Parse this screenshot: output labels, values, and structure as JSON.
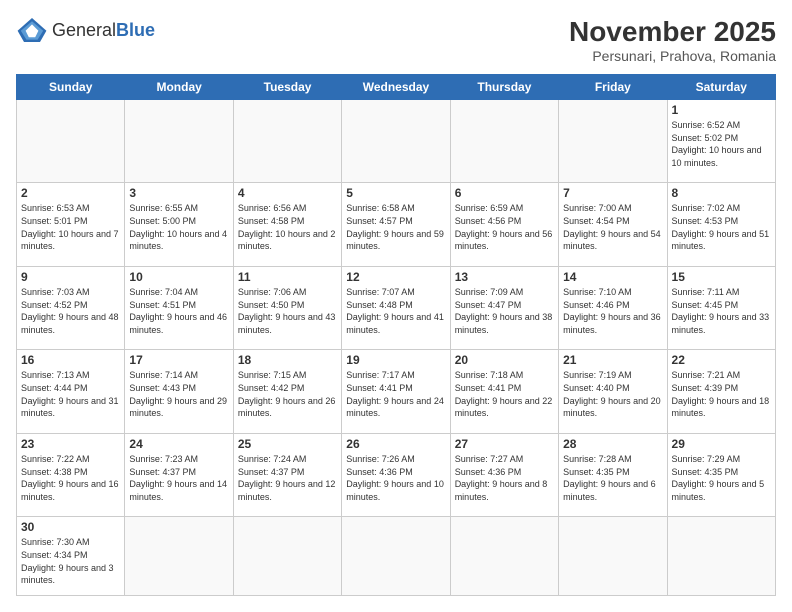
{
  "logo": {
    "text_general": "General",
    "text_blue": "Blue"
  },
  "header": {
    "month_year": "November 2025",
    "location": "Persunari, Prahova, Romania"
  },
  "days_of_week": [
    "Sunday",
    "Monday",
    "Tuesday",
    "Wednesday",
    "Thursday",
    "Friday",
    "Saturday"
  ],
  "weeks": [
    [
      {
        "day": "",
        "info": ""
      },
      {
        "day": "",
        "info": ""
      },
      {
        "day": "",
        "info": ""
      },
      {
        "day": "",
        "info": ""
      },
      {
        "day": "",
        "info": ""
      },
      {
        "day": "",
        "info": ""
      },
      {
        "day": "1",
        "info": "Sunrise: 6:52 AM\nSunset: 5:02 PM\nDaylight: 10 hours and 10 minutes."
      }
    ],
    [
      {
        "day": "2",
        "info": "Sunrise: 6:53 AM\nSunset: 5:01 PM\nDaylight: 10 hours and 7 minutes."
      },
      {
        "day": "3",
        "info": "Sunrise: 6:55 AM\nSunset: 5:00 PM\nDaylight: 10 hours and 4 minutes."
      },
      {
        "day": "4",
        "info": "Sunrise: 6:56 AM\nSunset: 4:58 PM\nDaylight: 10 hours and 2 minutes."
      },
      {
        "day": "5",
        "info": "Sunrise: 6:58 AM\nSunset: 4:57 PM\nDaylight: 9 hours and 59 minutes."
      },
      {
        "day": "6",
        "info": "Sunrise: 6:59 AM\nSunset: 4:56 PM\nDaylight: 9 hours and 56 minutes."
      },
      {
        "day": "7",
        "info": "Sunrise: 7:00 AM\nSunset: 4:54 PM\nDaylight: 9 hours and 54 minutes."
      },
      {
        "day": "8",
        "info": "Sunrise: 7:02 AM\nSunset: 4:53 PM\nDaylight: 9 hours and 51 minutes."
      }
    ],
    [
      {
        "day": "9",
        "info": "Sunrise: 7:03 AM\nSunset: 4:52 PM\nDaylight: 9 hours and 48 minutes."
      },
      {
        "day": "10",
        "info": "Sunrise: 7:04 AM\nSunset: 4:51 PM\nDaylight: 9 hours and 46 minutes."
      },
      {
        "day": "11",
        "info": "Sunrise: 7:06 AM\nSunset: 4:50 PM\nDaylight: 9 hours and 43 minutes."
      },
      {
        "day": "12",
        "info": "Sunrise: 7:07 AM\nSunset: 4:48 PM\nDaylight: 9 hours and 41 minutes."
      },
      {
        "day": "13",
        "info": "Sunrise: 7:09 AM\nSunset: 4:47 PM\nDaylight: 9 hours and 38 minutes."
      },
      {
        "day": "14",
        "info": "Sunrise: 7:10 AM\nSunset: 4:46 PM\nDaylight: 9 hours and 36 minutes."
      },
      {
        "day": "15",
        "info": "Sunrise: 7:11 AM\nSunset: 4:45 PM\nDaylight: 9 hours and 33 minutes."
      }
    ],
    [
      {
        "day": "16",
        "info": "Sunrise: 7:13 AM\nSunset: 4:44 PM\nDaylight: 9 hours and 31 minutes."
      },
      {
        "day": "17",
        "info": "Sunrise: 7:14 AM\nSunset: 4:43 PM\nDaylight: 9 hours and 29 minutes."
      },
      {
        "day": "18",
        "info": "Sunrise: 7:15 AM\nSunset: 4:42 PM\nDaylight: 9 hours and 26 minutes."
      },
      {
        "day": "19",
        "info": "Sunrise: 7:17 AM\nSunset: 4:41 PM\nDaylight: 9 hours and 24 minutes."
      },
      {
        "day": "20",
        "info": "Sunrise: 7:18 AM\nSunset: 4:41 PM\nDaylight: 9 hours and 22 minutes."
      },
      {
        "day": "21",
        "info": "Sunrise: 7:19 AM\nSunset: 4:40 PM\nDaylight: 9 hours and 20 minutes."
      },
      {
        "day": "22",
        "info": "Sunrise: 7:21 AM\nSunset: 4:39 PM\nDaylight: 9 hours and 18 minutes."
      }
    ],
    [
      {
        "day": "23",
        "info": "Sunrise: 7:22 AM\nSunset: 4:38 PM\nDaylight: 9 hours and 16 minutes."
      },
      {
        "day": "24",
        "info": "Sunrise: 7:23 AM\nSunset: 4:37 PM\nDaylight: 9 hours and 14 minutes."
      },
      {
        "day": "25",
        "info": "Sunrise: 7:24 AM\nSunset: 4:37 PM\nDaylight: 9 hours and 12 minutes."
      },
      {
        "day": "26",
        "info": "Sunrise: 7:26 AM\nSunset: 4:36 PM\nDaylight: 9 hours and 10 minutes."
      },
      {
        "day": "27",
        "info": "Sunrise: 7:27 AM\nSunset: 4:36 PM\nDaylight: 9 hours and 8 minutes."
      },
      {
        "day": "28",
        "info": "Sunrise: 7:28 AM\nSunset: 4:35 PM\nDaylight: 9 hours and 6 minutes."
      },
      {
        "day": "29",
        "info": "Sunrise: 7:29 AM\nSunset: 4:35 PM\nDaylight: 9 hours and 5 minutes."
      }
    ],
    [
      {
        "day": "30",
        "info": "Sunrise: 7:30 AM\nSunset: 4:34 PM\nDaylight: 9 hours and 3 minutes."
      },
      {
        "day": "",
        "info": ""
      },
      {
        "day": "",
        "info": ""
      },
      {
        "day": "",
        "info": ""
      },
      {
        "day": "",
        "info": ""
      },
      {
        "day": "",
        "info": ""
      },
      {
        "day": "",
        "info": ""
      }
    ]
  ]
}
